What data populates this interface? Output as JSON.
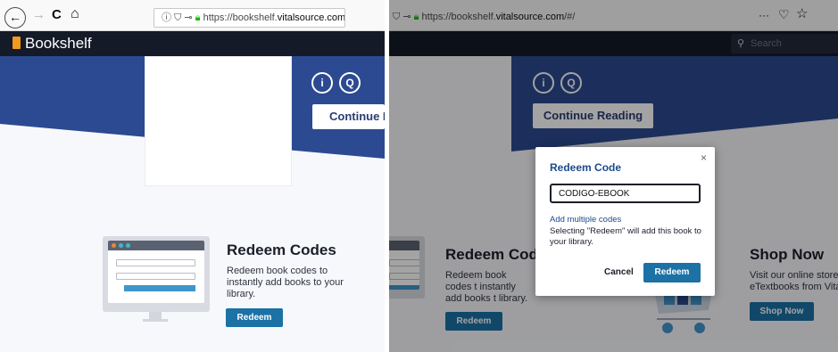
{
  "left_browser": {
    "back_glyph": "←",
    "forward_glyph": "→",
    "reload_glyph": "C",
    "home_glyph": "⌂",
    "url_prefix": "https://bookshelf.",
    "url_domain": "vitalsource.com",
    "url_suffix": "/#/"
  },
  "right_browser": {
    "url_prefix": "https://bookshelf.",
    "url_domain": "vitalsource.com",
    "url_suffix": "/#/",
    "more_glyph": "···",
    "pocket_glyph": "♡",
    "star_glyph": "☆"
  },
  "app": {
    "brand": "Bookshelf",
    "search_placeholder": "Search",
    "info_glyph": "i",
    "search_glyph": "Q",
    "continue_label": "Continue Reading",
    "continue_label_cut": "Continue Re"
  },
  "redeem_section": {
    "heading": "Redeem Codes",
    "body": "Redeem book codes to instantly add books to your library.",
    "button": "Redeem"
  },
  "right_section": {
    "heading_cut": "Redeem Code",
    "body_cut": "Redeem book codes t instantly add books t library.",
    "button": "Redeem"
  },
  "shop_section": {
    "heading": "Shop Now",
    "body_line1": "Visit our online store",
    "body_line2": "eTextbooks from Vita",
    "button": "Shop Now"
  },
  "modal": {
    "title": "Redeem Code",
    "close_glyph": "×",
    "code_value": "CODIGO-EBOOK",
    "add_multiple_link": "Add multiple codes",
    "help_text": "Selecting \"Redeem\" will add this book to your library.",
    "cancel_label": "Cancel",
    "redeem_label": "Redeem"
  },
  "colors": {
    "hero_blue": "#2c4a91",
    "header_dark": "#141a27",
    "accent_button": "#1c71a5",
    "brand_orange": "#f19b1f"
  }
}
